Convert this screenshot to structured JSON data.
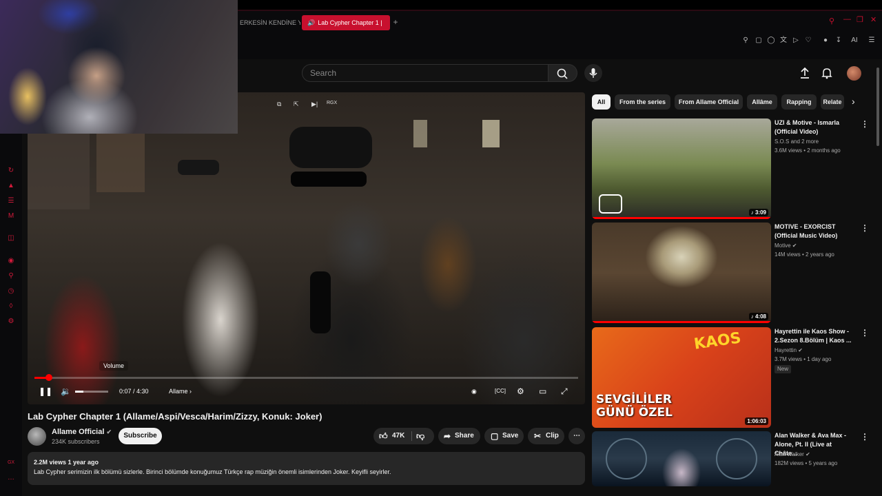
{
  "browser": {
    "tab_prev": "ERKESİN KENDİNE YAK",
    "tab_active": "Lab Cypher Chapter 1 |",
    "toolbar_ai": "AI"
  },
  "search": {
    "placeholder": "Search"
  },
  "player": {
    "volume_tooltip": "Volume",
    "time": "0:07 / 4:30",
    "chapter": "Allame",
    "rgx": "RGX",
    "progress_fraction": 0.027,
    "volume_fraction": 0.25
  },
  "video": {
    "title": "Lab Cypher Chapter 1 (Allame/Aspi/Vesca/Harim/Zizzy, Konuk: Joker)",
    "channel": "Allame Official",
    "subscribers": "234K subscribers",
    "subscribe_label": "Subscribe",
    "likes": "47K",
    "share_label": "Share",
    "save_label": "Save",
    "clip_label": "Clip",
    "views_age": "2.2M views  1 year ago",
    "description": "Lab Cypher serimizin ilk bölümü sizlerle. Birinci bölümde konuğumuz Türkçe rap müziğin önemli isimlerinden Joker. Keyifli seyirler."
  },
  "chips": [
    "All",
    "From the series",
    "From Allame Official",
    "Allâme",
    "Rapping",
    "Relate"
  ],
  "recs": [
    {
      "title": "UZI & Motive - Ismarla (Official Video)",
      "channel": "S.O.S and 2 more",
      "meta": "3.6M views • 2 months ago",
      "duration": "3:09"
    },
    {
      "title": "MOTIVE - EXORCIST (Official Music Video)",
      "channel": "Motive",
      "meta": "14M views • 2 years ago",
      "duration": "4:08"
    },
    {
      "title": "Hayrettin ile Kaos Show - 2.Sezon 8.Bölüm | Kaos ...",
      "channel": "Hayrettin",
      "meta": "3.7M views • 1 day ago",
      "duration": "1:06:03",
      "badge": "New",
      "thumb_text": "SEVGİLİLER GÜNÜ ÖZEL",
      "thumb_logo": "KAOS"
    },
    {
      "title": "Alan Walker & Ava Max - Alone, Pt. II (Live at Châte...",
      "channel": "Alan Walker",
      "meta": "182M views • 5 years ago",
      "duration": ""
    }
  ],
  "colors": {
    "accent": "#ff0000",
    "browser_accent": "#c8102e",
    "background": "#0f0f0f"
  }
}
